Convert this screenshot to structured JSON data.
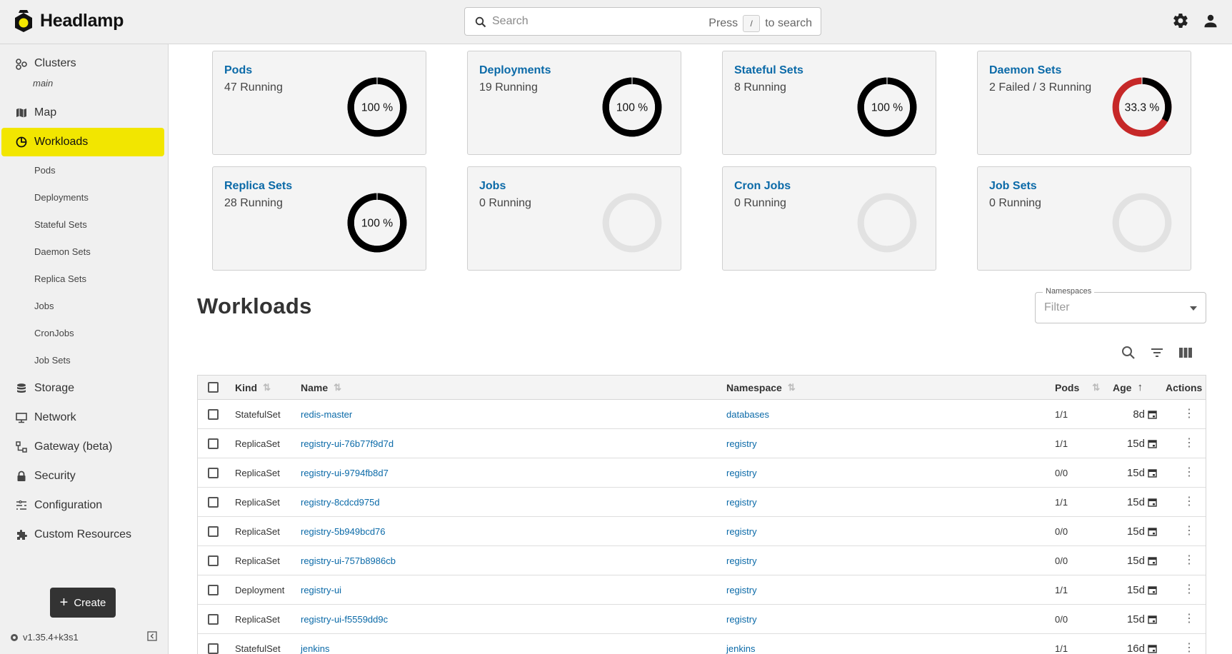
{
  "app": {
    "name": "Headlamp"
  },
  "search": {
    "placeholder": "Search",
    "hint_before": "Press",
    "hint_key": "/",
    "hint_after": "to search"
  },
  "sidebar": {
    "clusters_label": "Clusters",
    "cluster_name": "main",
    "map_label": "Map",
    "workloads_label": "Workloads",
    "workload_children": [
      "Pods",
      "Deployments",
      "Stateful Sets",
      "Daemon Sets",
      "Replica Sets",
      "Jobs",
      "CronJobs",
      "Job Sets"
    ],
    "storage_label": "Storage",
    "network_label": "Network",
    "gateway_label": "Gateway (beta)",
    "security_label": "Security",
    "configuration_label": "Configuration",
    "custom_resources_label": "Custom Resources",
    "create_label": "Create",
    "version": "v1.35.4+k3s1"
  },
  "cards": [
    {
      "title": "Pods",
      "status": "47 Running",
      "ratio": 1.0,
      "label": "100 %",
      "failed": false
    },
    {
      "title": "Deployments",
      "status": "19 Running",
      "ratio": 1.0,
      "label": "100 %",
      "failed": false
    },
    {
      "title": "Stateful Sets",
      "status": "8 Running",
      "ratio": 1.0,
      "label": "100 %",
      "failed": false
    },
    {
      "title": "Daemon Sets",
      "status": "2 Failed / 3 Running",
      "ratio": 0.333,
      "label": "33.3 %",
      "failed": true
    },
    {
      "title": "Replica Sets",
      "status": "28 Running",
      "ratio": 1.0,
      "label": "100 %",
      "failed": false
    },
    {
      "title": "Jobs",
      "status": "0 Running",
      "ratio": 0,
      "label": "",
      "failed": false
    },
    {
      "title": "Cron Jobs",
      "status": "0 Running",
      "ratio": 0,
      "label": "",
      "failed": false
    },
    {
      "title": "Job Sets",
      "status": "0 Running",
      "ratio": 0,
      "label": "",
      "failed": false
    }
  ],
  "colors": {
    "ring_ok": "#000000",
    "ring_fail": "#c62828",
    "ring_empty": "#e2e2e2",
    "link": "#0b6aa8",
    "active_nav": "#f2e600"
  },
  "workloads": {
    "title": "Workloads",
    "namespaces_label": "Namespaces",
    "namespaces_placeholder": "Filter",
    "columns": {
      "kind": "Kind",
      "name": "Name",
      "namespace": "Namespace",
      "pods": "Pods",
      "age": "Age",
      "actions": "Actions"
    },
    "rows": [
      {
        "kind": "StatefulSet",
        "name": "redis-master",
        "namespace": "databases",
        "pods": "1/1",
        "age": "8d"
      },
      {
        "kind": "ReplicaSet",
        "name": "registry-ui-76b77f9d7d",
        "namespace": "registry",
        "pods": "1/1",
        "age": "15d"
      },
      {
        "kind": "ReplicaSet",
        "name": "registry-ui-9794fb8d7",
        "namespace": "registry",
        "pods": "0/0",
        "age": "15d"
      },
      {
        "kind": "ReplicaSet",
        "name": "registry-8cdcd975d",
        "namespace": "registry",
        "pods": "1/1",
        "age": "15d"
      },
      {
        "kind": "ReplicaSet",
        "name": "registry-5b949bcd76",
        "namespace": "registry",
        "pods": "0/0",
        "age": "15d"
      },
      {
        "kind": "ReplicaSet",
        "name": "registry-ui-757b8986cb",
        "namespace": "registry",
        "pods": "0/0",
        "age": "15d"
      },
      {
        "kind": "Deployment",
        "name": "registry-ui",
        "namespace": "registry",
        "pods": "1/1",
        "age": "15d"
      },
      {
        "kind": "ReplicaSet",
        "name": "registry-ui-f5559dd9c",
        "namespace": "registry",
        "pods": "0/0",
        "age": "15d"
      },
      {
        "kind": "StatefulSet",
        "name": "jenkins",
        "namespace": "jenkins",
        "pods": "1/1",
        "age": "16d"
      }
    ]
  }
}
